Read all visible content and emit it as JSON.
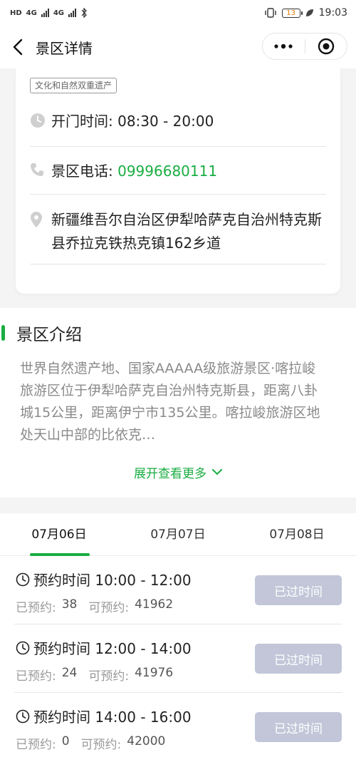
{
  "status_bar": {
    "net_left": "HD",
    "sig1": "4G",
    "sig2": "4G",
    "battery": "13",
    "time": "19:03"
  },
  "nav": {
    "title": "景区详情",
    "icons": [
      "back-arrow-icon",
      "more-dots-icon",
      "close-target-icon"
    ]
  },
  "info": {
    "tag": "文化和自然双重遗产",
    "hours_label": "开门时间: ",
    "hours_value": "08:30 - 20:00",
    "phone_label": "景区电话: ",
    "phone_value": "09996680111",
    "address": "新疆维吾尔自治区伊犁哈萨克自治州特克斯县乔拉克铁热克镇162乡道"
  },
  "intro": {
    "title": "景区介绍",
    "body": "世界自然遗产地、国家AAAAA级旅游景区·喀拉峻旅游区位于伊犁哈萨克自治州特克斯县，距离八卦城15公里，距离伊宁市135公里。喀拉峻旅游区地处天山中部的比依克…",
    "expand": "展开查看更多"
  },
  "booking": {
    "tabs": [
      {
        "label": "07月06日"
      },
      {
        "label": "07月07日"
      },
      {
        "label": "07月08日"
      }
    ],
    "active_tab": 0,
    "accent_color": "#1aad42",
    "slots": [
      {
        "time": "预约时间 10:00 - 12:00",
        "booked_label": "已预约:",
        "booked": "38",
        "avail_label": "可预约:",
        "avail": "41962",
        "button": "已过时间"
      },
      {
        "time": "预约时间 12:00 - 14:00",
        "booked_label": "已预约:",
        "booked": "24",
        "avail_label": "可预约:",
        "avail": "41976",
        "button": "已过时间"
      },
      {
        "time": "预约时间 14:00 - 16:00",
        "booked_label": "已预约:",
        "booked": "0",
        "avail_label": "可预约:",
        "avail": "42000",
        "button": "已过时间"
      }
    ]
  }
}
